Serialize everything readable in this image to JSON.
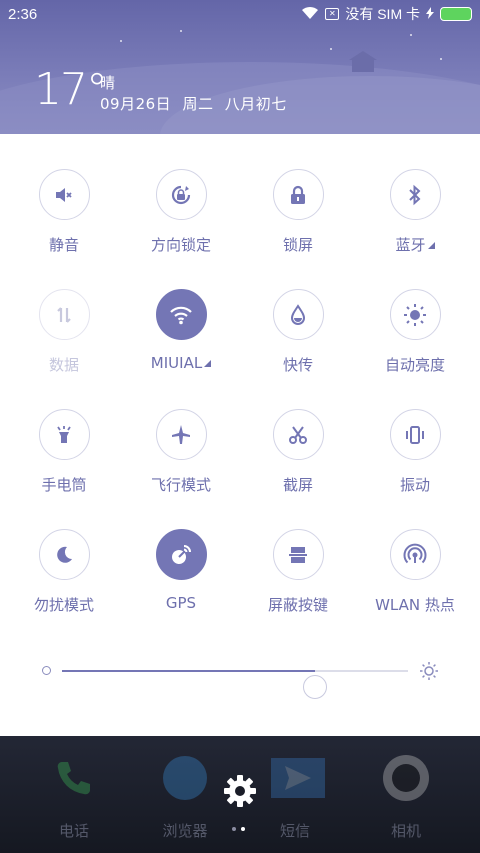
{
  "status_bar": {
    "time": "2:36",
    "carrier": "没有 SIM 卡",
    "wifi_icon": "wifi-icon",
    "battery_icon": "battery-icon"
  },
  "weather": {
    "temperature": "17°",
    "condition": "晴",
    "date": "09月26日",
    "weekday": "周二",
    "lunar": "八月初七"
  },
  "tiles": [
    {
      "label": "静音",
      "icon": "mute-icon",
      "active": false
    },
    {
      "label": "方向锁定",
      "icon": "rotation-lock-icon",
      "active": false
    },
    {
      "label": "锁屏",
      "icon": "lock-icon",
      "active": false
    },
    {
      "label": "蓝牙",
      "icon": "bluetooth-icon",
      "active": false,
      "has_more": true
    },
    {
      "label": "数据",
      "icon": "mobile-data-icon",
      "active": false,
      "disabled": true
    },
    {
      "label": "MIUIAL",
      "icon": "wifi-icon",
      "active": true,
      "has_more": true
    },
    {
      "label": "快传",
      "icon": "drop-icon",
      "active": false
    },
    {
      "label": "自动亮度",
      "icon": "auto-brightness-icon",
      "active": false
    },
    {
      "label": "手电筒",
      "icon": "flashlight-icon",
      "active": false
    },
    {
      "label": "飞行模式",
      "icon": "airplane-icon",
      "active": false
    },
    {
      "label": "截屏",
      "icon": "scissors-icon",
      "active": false
    },
    {
      "label": "振动",
      "icon": "vibrate-icon",
      "active": false
    },
    {
      "label": "勿扰模式",
      "icon": "moon-icon",
      "active": false
    },
    {
      "label": "GPS",
      "icon": "gps-icon",
      "active": true
    },
    {
      "label": "屏蔽按键",
      "icon": "block-keys-icon",
      "active": false
    },
    {
      "label": "WLAN 热点",
      "icon": "hotspot-icon",
      "active": false
    }
  ],
  "brightness": {
    "level": 0.73
  },
  "dock": [
    {
      "label": "电话",
      "icon": "phone-icon"
    },
    {
      "label": "浏览器",
      "icon": "browser-icon"
    },
    {
      "label": "短信",
      "icon": "message-icon"
    },
    {
      "label": "相机",
      "icon": "camera-icon"
    }
  ],
  "colors": {
    "accent": "#7476b5",
    "header": "#6a6cad",
    "battery": "#5ed45e"
  }
}
